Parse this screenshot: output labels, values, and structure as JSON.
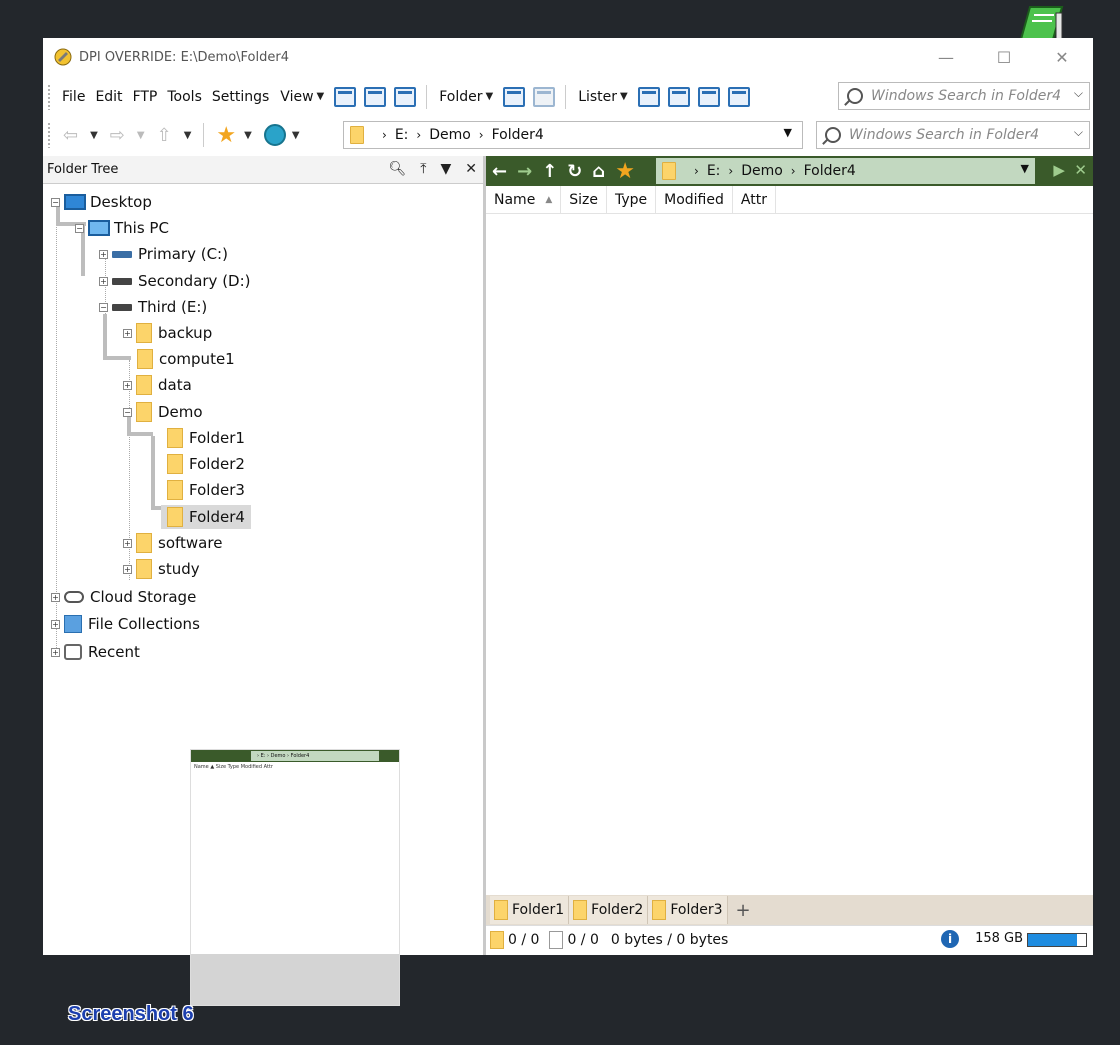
{
  "window": {
    "title": "DPI OVERRIDE: E:\\Demo\\Folder4",
    "controls": {
      "minimize": "—",
      "maximize": "☐",
      "close": "✕"
    }
  },
  "menu": {
    "items": [
      "File",
      "Edit",
      "FTP",
      "Tools",
      "Settings"
    ],
    "view_label": "View",
    "folder_label": "Folder",
    "lister_label": "Lister",
    "search_placeholder": "Windows Search in Folder4"
  },
  "navbar": {
    "path_segments": [
      "E:",
      "Demo",
      "Folder4"
    ],
    "search_placeholder": "Windows Search in Folder4"
  },
  "tree": {
    "header": "Folder Tree",
    "nodes": {
      "desktop": "Desktop",
      "thispc": "This PC",
      "primary": "Primary (C:)",
      "secondary": "Secondary (D:)",
      "third": "Third (E:)",
      "backup": "backup",
      "compute1": "compute1",
      "data": "data",
      "demo": "Demo",
      "folder1": "Folder1",
      "folder2": "Folder2",
      "folder3": "Folder3",
      "folder4": "Folder4",
      "software": "software",
      "study": "study",
      "cloud": "Cloud Storage",
      "collections": "File Collections",
      "recent": "Recent"
    }
  },
  "lister": {
    "path_segments": [
      "E:",
      "Demo",
      "Folder4"
    ],
    "columns": [
      "Name",
      "Size",
      "Type",
      "Modified",
      "Attr"
    ],
    "tabs": [
      "Folder1",
      "Folder2",
      "Folder3"
    ],
    "tab_add": "+"
  },
  "status": {
    "folders": "0 / 0",
    "files": "0 / 0",
    "bytes": "0 bytes / 0 bytes",
    "disk_free": "158 GB",
    "disk_used_fraction": 0.85
  },
  "thumbnail": {
    "path": "› E: › Demo › Folder4",
    "columns": "Name  ▲  Size  Type  Modified  Attr"
  },
  "caption": "Screenshot 6",
  "colors": {
    "lister_bar": "#3a5a2a",
    "path_bg": "#c2d8c0",
    "folder": "#fcd46a",
    "accent": "#1e8ce0"
  }
}
